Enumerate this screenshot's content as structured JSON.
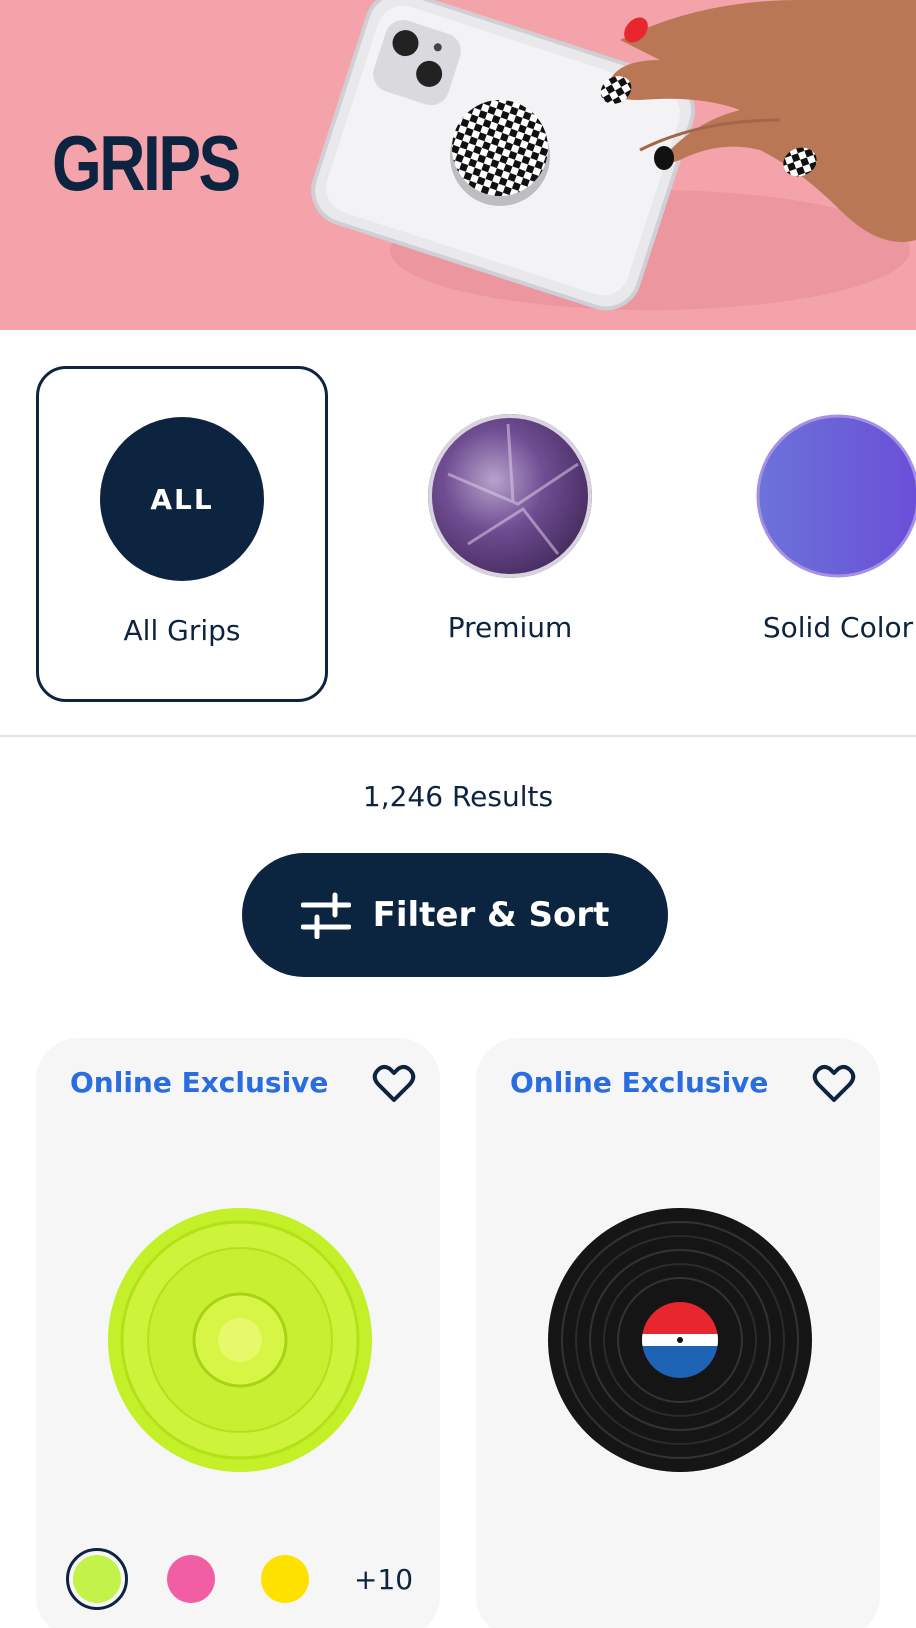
{
  "hero": {
    "title": "GRIPS"
  },
  "categories": [
    {
      "badge": "ALL",
      "label": "All Grips",
      "selected": true
    },
    {
      "badge": "",
      "label": "Premium",
      "selected": false
    },
    {
      "badge": "",
      "label": "Solid Color",
      "selected": false
    }
  ],
  "results": {
    "count_text": "1,246 Results"
  },
  "filter": {
    "label": "Filter & Sort"
  },
  "products": [
    {
      "badge": "Online Exclusive",
      "swatches": [
        "#c3f24a",
        "#f25ea3",
        "#ffe100"
      ],
      "more": "+10"
    },
    {
      "badge": "Online Exclusive"
    }
  ],
  "colors": {
    "navy": "#0d2440",
    "hero_bg": "#f5a3ab",
    "badge_blue": "#2a6de0",
    "card_bg": "#f6f6f6"
  }
}
